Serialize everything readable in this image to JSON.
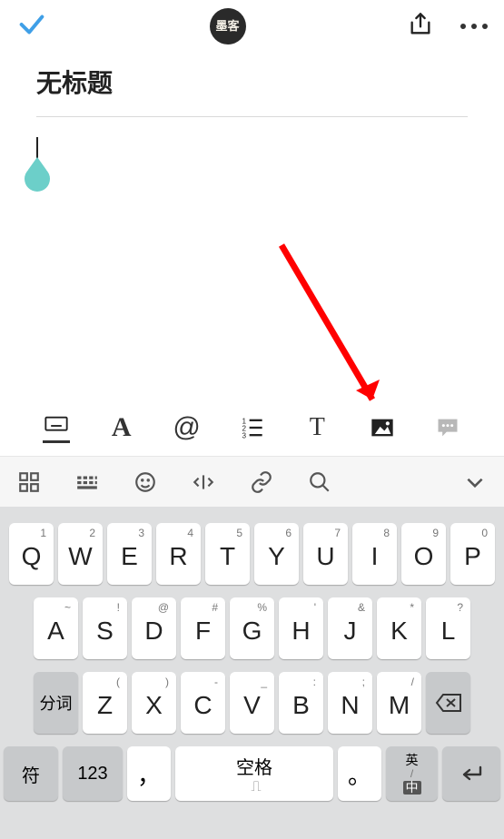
{
  "topbar": {
    "logo_text": "墨客"
  },
  "editor": {
    "title_placeholder": "无标题"
  },
  "editor_toolbar": {
    "A": "A",
    "at": "@",
    "T": "T"
  },
  "keyboard": {
    "row1": [
      {
        "sup": "1",
        "main": "Q"
      },
      {
        "sup": "2",
        "main": "W"
      },
      {
        "sup": "3",
        "main": "E"
      },
      {
        "sup": "4",
        "main": "R"
      },
      {
        "sup": "5",
        "main": "T"
      },
      {
        "sup": "6",
        "main": "Y"
      },
      {
        "sup": "7",
        "main": "U"
      },
      {
        "sup": "8",
        "main": "I"
      },
      {
        "sup": "9",
        "main": "O"
      },
      {
        "sup": "0",
        "main": "P"
      }
    ],
    "row2": [
      {
        "sup": "~",
        "main": "A"
      },
      {
        "sup": "!",
        "main": "S"
      },
      {
        "sup": "@",
        "main": "D"
      },
      {
        "sup": "#",
        "main": "F"
      },
      {
        "sup": "%",
        "main": "G"
      },
      {
        "sup": "'",
        "main": "H"
      },
      {
        "sup": "&",
        "main": "J"
      },
      {
        "sup": "*",
        "main": "K"
      },
      {
        "sup": "?",
        "main": "L"
      }
    ],
    "row3": [
      {
        "sup": "(",
        "main": "Z"
      },
      {
        "sup": ")",
        "main": "X"
      },
      {
        "sup": "-",
        "main": "C"
      },
      {
        "sup": "_",
        "main": "V"
      },
      {
        "sup": ":",
        "main": "B"
      },
      {
        "sup": ";",
        "main": "N"
      },
      {
        "sup": "/",
        "main": "M"
      }
    ],
    "fenci": "分词",
    "fu": "符",
    "num": "123",
    "comma": "，",
    "space": "空格",
    "period": "。",
    "lang_top": "英",
    "lang_bot": "中"
  }
}
